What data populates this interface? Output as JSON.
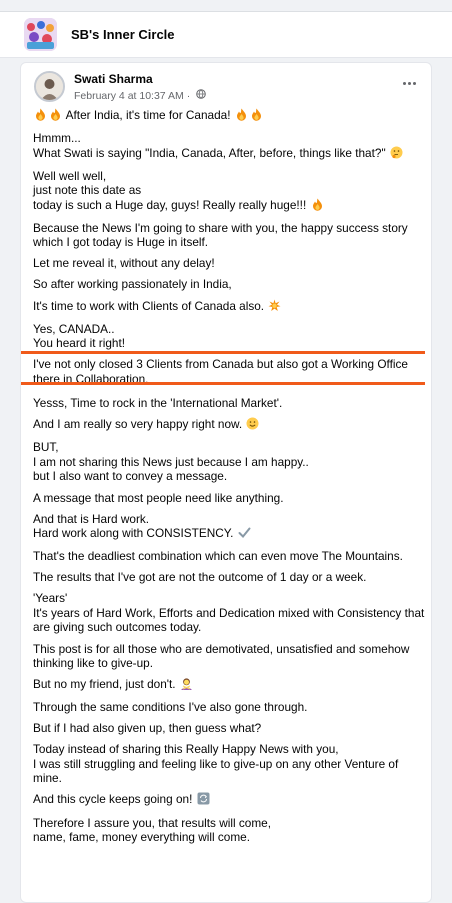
{
  "group": {
    "name": "SB's Inner Circle"
  },
  "post": {
    "author": "Swati Sharma",
    "timestamp": "February 4 at 10:37 AM",
    "separator": "·",
    "more_icon": "more-horizontal-icon",
    "visibility_icon": "globe-icon",
    "paragraphs": [
      {
        "text": "After India, it's time for Canada!",
        "pre_emoji": "fire fire",
        "post_emoji": "fire fire"
      },
      {
        "text": "Hmmm...\nWhat Swati is saying \"India, Canada, After, before, things like that?\"",
        "post_emoji": "thinking-face"
      },
      {
        "text": "Well well well,\njust note this date as\ntoday is such a Huge day, guys! Really really huge!!!",
        "post_emoji": "fire"
      },
      {
        "text": "Because the News I'm going to share with you, the happy success story which I got today is Huge in itself."
      },
      {
        "text": "Let me reveal it, without any delay!"
      },
      {
        "text": "So after working passionately in India,"
      },
      {
        "text": "It's time to work with Clients of Canada also.",
        "post_emoji": "collision"
      },
      {
        "text": "Yes, CANADA..\nYou heard it right!"
      },
      {
        "text": "I've not only closed 3 Clients from Canada but also got a Working Office there in Collaboration.",
        "highlighted": true
      },
      {
        "text": "Yesss, Time to rock in the 'International Market'."
      },
      {
        "text": "And I am really so very happy right now.",
        "post_emoji": "smiling-face"
      },
      {
        "text": "BUT,\nI am not sharing this News just because I am happy..\nbut I also want to convey a message."
      },
      {
        "text": "A message that most people need like anything."
      },
      {
        "text": "And that is Hard work.\nHard work along with CONSISTENCY.",
        "post_emoji": "check-mark"
      },
      {
        "text": "That's the deadliest combination which can even move The Mountains."
      },
      {
        "text": "The results that I've got are not the outcome of 1 day or a week."
      },
      {
        "text": "'Years'\nIt's years of Hard Work, Efforts and Dedication mixed with Consistency that are giving such outcomes today."
      },
      {
        "text": "This post is for all those who are demotivated, unsatisfied and somehow thinking like to give-up."
      },
      {
        "text": "But no my friend, just don't.",
        "post_emoji": "person-gesturing-no"
      },
      {
        "text": "Through the same conditions I've also gone through."
      },
      {
        "text": "But if I had also given up, then guess what?"
      },
      {
        "text": "Today instead of sharing this Really Happy News with you,\nI was still struggling and feeling like to give-up on any other Venture of mine."
      },
      {
        "text": "And this cycle keeps going on!",
        "post_emoji": "repeat-button"
      },
      {
        "text": "Therefore I assure you, that results will come,\nname, fame, money everything will come."
      }
    ],
    "highlight_color": "#f05a1a"
  }
}
